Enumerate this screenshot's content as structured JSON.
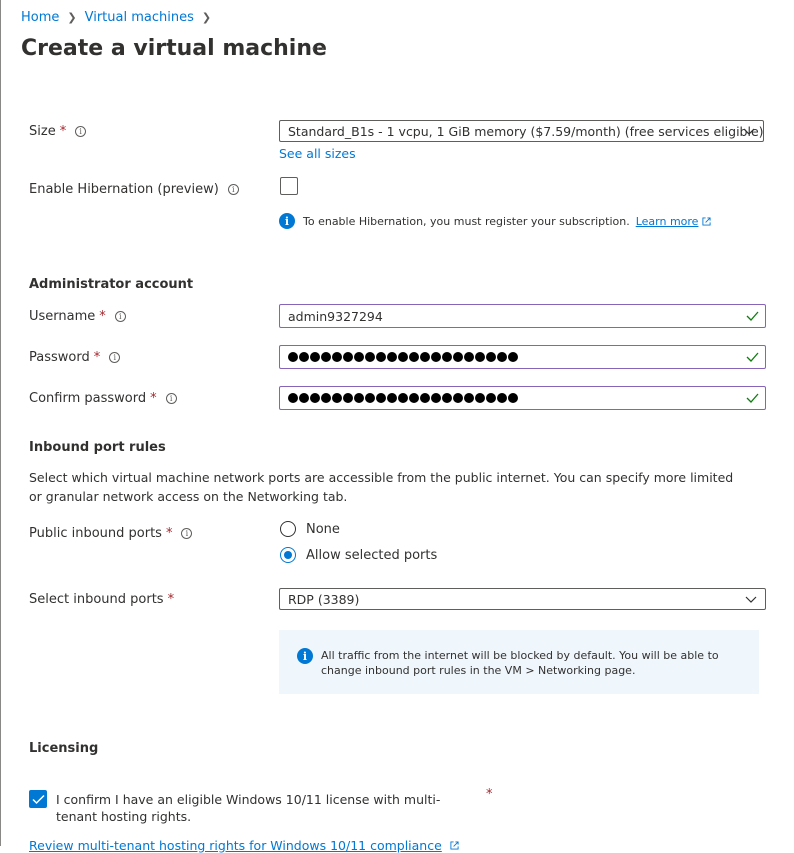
{
  "breadcrumb": {
    "home": "Home",
    "vms": "Virtual machines"
  },
  "page": {
    "title": "Create a virtual machine",
    "more": "···"
  },
  "size": {
    "label": "Size",
    "value": "Standard_B1s - 1 vcpu, 1 GiB memory ($7.59/month)  (free services eligible)",
    "see_all": "See all sizes"
  },
  "hibernation": {
    "label": "Enable Hibernation (preview)",
    "checked": false,
    "hint": "To enable Hibernation, you must register your subscription.",
    "learn_more": "Learn more"
  },
  "admin": {
    "heading": "Administrator account",
    "username_label": "Username",
    "username_value": "admin9327294",
    "password_label": "Password",
    "confirm_label": "Confirm password",
    "password_dot_count": 21
  },
  "inbound": {
    "heading": "Inbound port rules",
    "description": "Select which virtual machine network ports are accessible from the public internet. You can specify more limited or granular network access on the Networking tab.",
    "public_label": "Public inbound ports",
    "options": [
      "None",
      "Allow selected ports"
    ],
    "selected_option": "Allow selected ports",
    "select_label": "Select inbound ports",
    "select_value": "RDP (3389)",
    "info": "All traffic from the internet will be blocked by default. You will be able to change inbound port rules in the VM > Networking page."
  },
  "licensing": {
    "heading": "Licensing",
    "confirm_text": "I confirm I have an eligible Windows 10/11 license with multi-tenant hosting rights.",
    "confirmed": true,
    "review_link": "Review multi-tenant hosting rights for Windows 10/11 compliance"
  },
  "common": {
    "required_mark": "*",
    "info_glyph": "i"
  },
  "colors": {
    "accent": "#0078d4",
    "required": "#a4262c",
    "valid": "#107c10",
    "info_bg": "#eff6fc"
  }
}
